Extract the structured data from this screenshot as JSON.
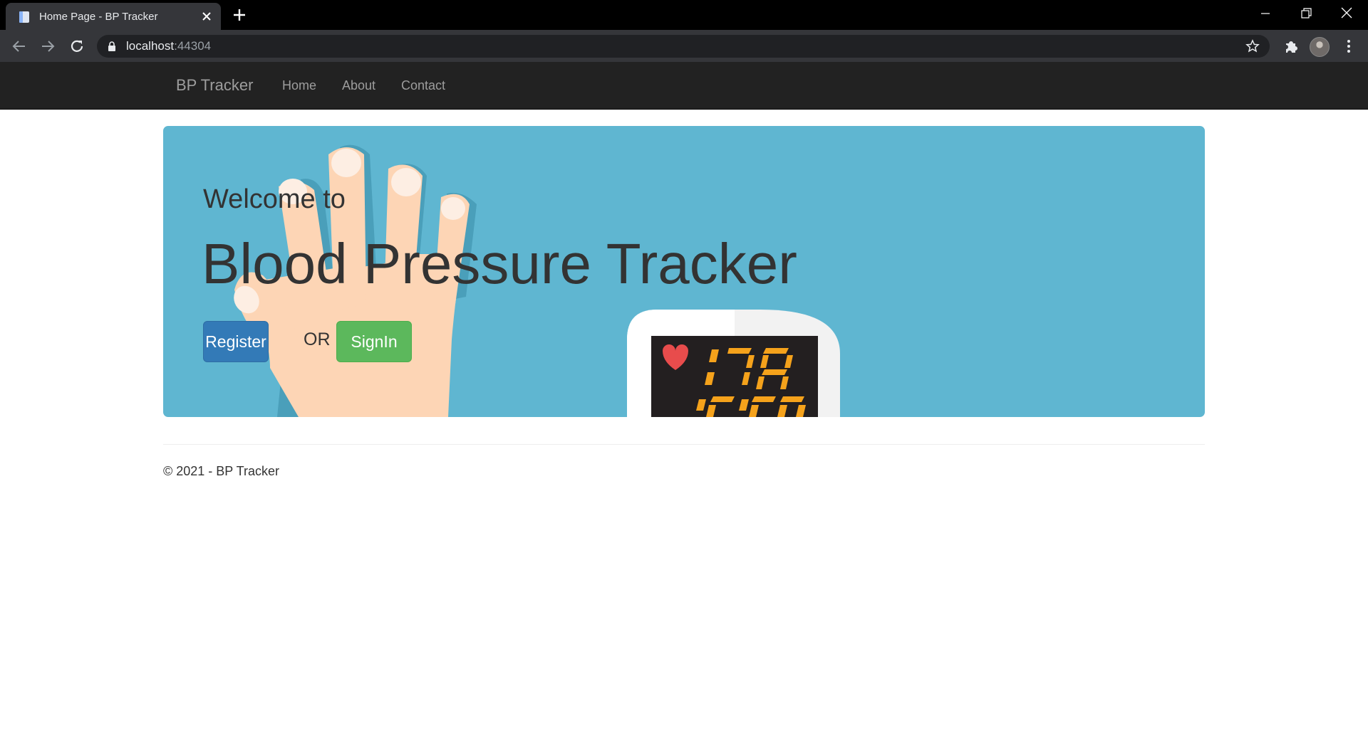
{
  "browser": {
    "tab_title": "Home Page - BP Tracker",
    "url_host": "localhost",
    "url_port": ":44304"
  },
  "site": {
    "brand": "BP Tracker",
    "nav": [
      "Home",
      "About",
      "Contact"
    ]
  },
  "hero": {
    "welcome": "Welcome to",
    "title": "Blood Pressure Tracker",
    "register_label": "Register",
    "or_label": "OR",
    "signin_label": "SignIn",
    "monitor_reading": "120"
  },
  "footer": {
    "text": "© 2021 - BP Tracker"
  },
  "colors": {
    "jumbotron": "#5fb6d1",
    "navbar": "#222222",
    "register": "#337ab7",
    "signin": "#5cb85c",
    "display_digits": "#f5a21b"
  },
  "icons": [
    "page-favicon-icon",
    "close-icon",
    "plus-icon",
    "minimize-icon",
    "restore-icon",
    "window-close-icon",
    "back-arrow-icon",
    "forward-arrow-icon",
    "reload-icon",
    "lock-icon",
    "star-icon",
    "extensions-icon",
    "kebab-menu-icon",
    "heart-icon",
    "hand-illustration",
    "blood-pressure-monitor-illustration"
  ]
}
